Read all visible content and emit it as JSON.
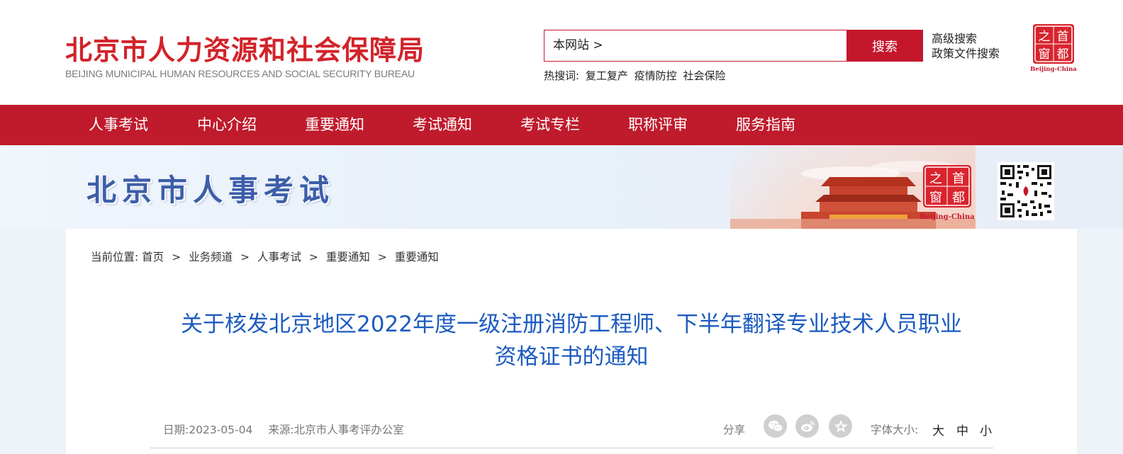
{
  "header": {
    "logo_cn": "北京市人力资源和社会保障局",
    "logo_en": "BEIJING MUNICIPAL HUMAN RESOURCES AND SOCIAL SECURITY BUREAU",
    "search_scope": "本网站 >",
    "search_button": "搜索",
    "advanced_search": "高级搜索",
    "policy_search": "政策文件搜索",
    "hot_label": "热搜词:",
    "hot_words": [
      "复工复产",
      "疫情防控",
      "社会保险"
    ],
    "badge_chars": [
      "之",
      "首",
      "窗",
      "都"
    ],
    "badge_en": "Beijing-China"
  },
  "nav": {
    "items": [
      "人事考试",
      "中心介绍",
      "重要通知",
      "考试通知",
      "考试专栏",
      "职称评审",
      "服务指南"
    ]
  },
  "banner": {
    "title": "北京市人事考试",
    "badge_chars": [
      "之",
      "首",
      "窗",
      "都"
    ],
    "badge_en": "Beijing-China"
  },
  "breadcrumb": {
    "label": "当前位置:",
    "items": [
      "首页",
      "业务频道",
      "人事考试",
      "重要通知",
      "重要通知"
    ],
    "separator": ">"
  },
  "article": {
    "title_line1": "关于核发北京地区2022年度一级注册消防工程师、下半年翻译专业技术人员职业",
    "title_line2": "资格证书的通知",
    "date_label": "日期:",
    "date": "2023-05-04",
    "source_label": "来源:",
    "source": "北京市人事考评办公室",
    "share_label": "分享",
    "share_icons": [
      "wechat-icon",
      "weibo-icon",
      "favorite-icon"
    ],
    "font_size_label": "字体大小:",
    "font_sizes": [
      "大",
      "中",
      "小"
    ]
  },
  "colors": {
    "brand_red": "#c4172c",
    "nav_red": "#bf1b2c",
    "title_blue": "#1c5bbf",
    "banner_blue": "#3c5ea9"
  }
}
